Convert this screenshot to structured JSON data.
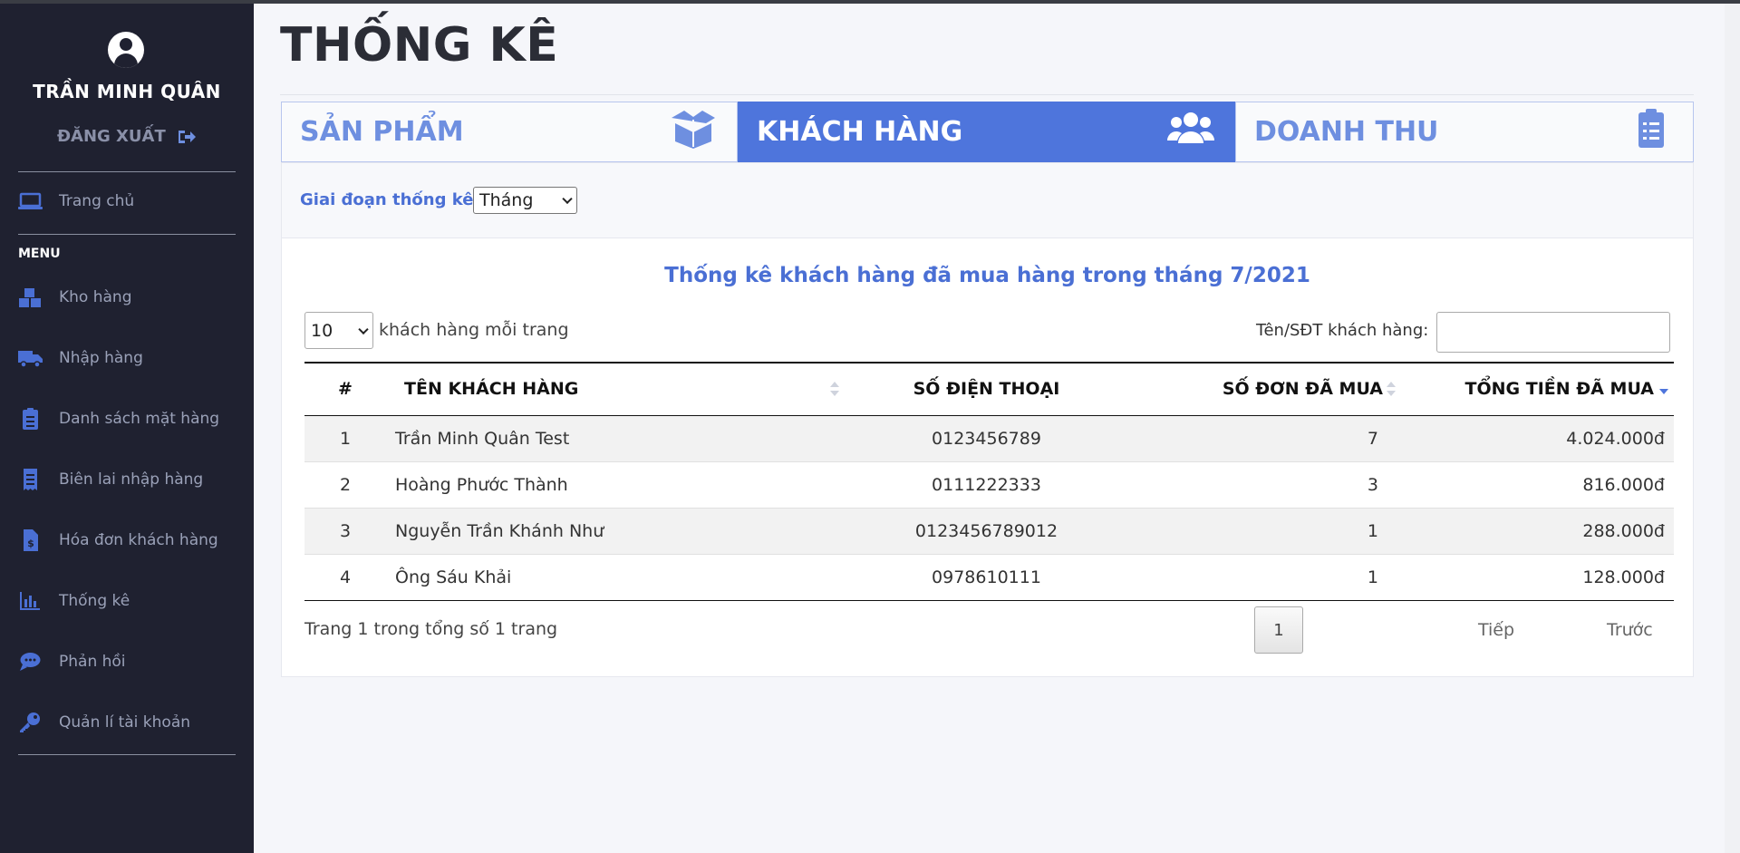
{
  "user": {
    "name": "TRẦN MINH QUÂN",
    "logout_label": "ĐĂNG XUẤT"
  },
  "sidebar": {
    "home": {
      "label": "Trang chủ",
      "icon": "laptop-icon"
    },
    "menu_heading": "MENU",
    "items": [
      {
        "label": "Kho hàng",
        "icon": "warehouse-icon"
      },
      {
        "label": "Nhập hàng",
        "icon": "truck-icon"
      },
      {
        "label": "Danh sách mặt hàng",
        "icon": "clipboard-list-icon"
      },
      {
        "label": "Biên lai nhập hàng",
        "icon": "receipt-icon"
      },
      {
        "label": "Hóa đơn khách hàng",
        "icon": "invoice-dollar-icon"
      },
      {
        "label": "Thống kê",
        "icon": "bar-chart-icon"
      },
      {
        "label": "Phản hồi",
        "icon": "comment-icon"
      },
      {
        "label": "Quản lí tài khoản",
        "icon": "key-icon"
      }
    ]
  },
  "page": {
    "title": "THỐNG KÊ"
  },
  "tabs": [
    {
      "label": "SẢN PHẨM",
      "icon": "box-icon",
      "active": false
    },
    {
      "label": "KHÁCH HÀNG",
      "icon": "users-icon",
      "active": true
    },
    {
      "label": "DOANH THU",
      "icon": "clipboard-icon",
      "active": false
    }
  ],
  "filter": {
    "label": "Giai đoạn thống kê:",
    "selected": "Tháng"
  },
  "table_section": {
    "title": "Thống kê khách hàng đã mua hàng trong tháng 7/2021",
    "page_size": "10",
    "page_size_suffix": "khách hàng mỗi trang",
    "search_label": "Tên/SĐT khách hàng:",
    "search_value": "",
    "columns": [
      "#",
      "TÊN KHÁCH HÀNG",
      "SỐ ĐIỆN THOẠI",
      "SỐ ĐƠN ĐÃ MUA",
      "TỔNG TIỀN ĐÃ MUA"
    ],
    "rows": [
      [
        "1",
        "Trần Minh Quân Test",
        "0123456789",
        "7",
        "4.024.000đ"
      ],
      [
        "2",
        "Hoàng Phước Thành",
        "0111222333",
        "3",
        "816.000đ"
      ],
      [
        "3",
        "Nguyễn Trần Khánh Như",
        "0123456789012",
        "1",
        "288.000đ"
      ],
      [
        "4",
        "Ông Sáu Khải",
        "0978610111",
        "1",
        "128.000đ"
      ]
    ],
    "info": "Trang 1 trong tổng số 1 trang",
    "pager": {
      "next": "Tiếp",
      "current": "1",
      "prev": "Trước"
    }
  },
  "colors": {
    "accent": "#4e75dc",
    "sidebar_bg": "#1f2130",
    "sidebar_icon": "#4a6fd4"
  }
}
